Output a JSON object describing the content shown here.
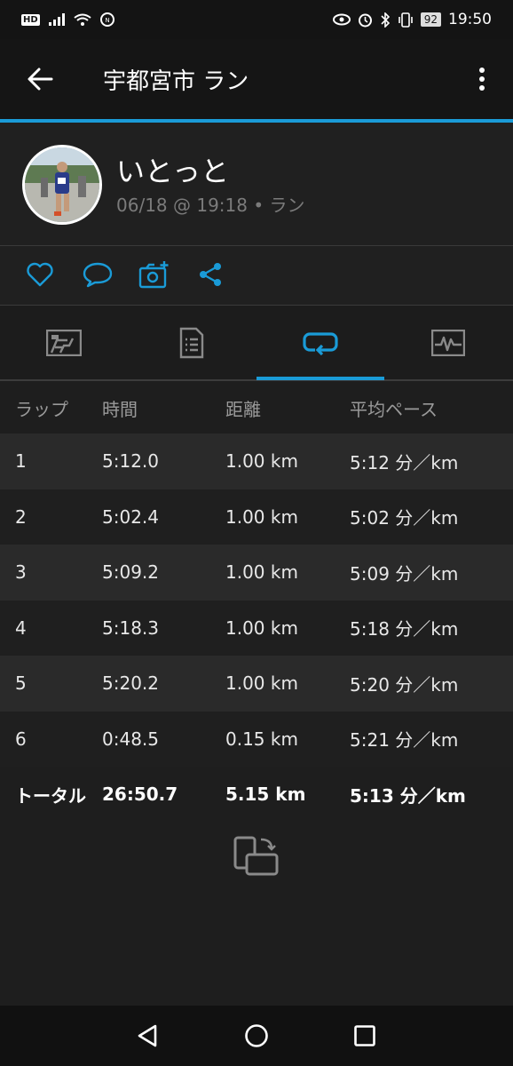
{
  "status_bar": {
    "hd": "HD",
    "battery": "92",
    "time": "19:50"
  },
  "app_bar": {
    "title": "宇都宮市 ラン"
  },
  "profile": {
    "name": "いとっと",
    "meta": "06/18 @ 19:18 • ラン"
  },
  "table": {
    "headers": {
      "lap": "ラップ",
      "time": "時間",
      "distance": "距離",
      "pace": "平均ペース"
    },
    "rows": [
      {
        "lap": "1",
        "time": "5:12.0",
        "distance": "1.00 km",
        "pace": "5:12 分／km"
      },
      {
        "lap": "2",
        "time": "5:02.4",
        "distance": "1.00 km",
        "pace": "5:02 分／km"
      },
      {
        "lap": "3",
        "time": "5:09.2",
        "distance": "1.00 km",
        "pace": "5:09 分／km"
      },
      {
        "lap": "4",
        "time": "5:18.3",
        "distance": "1.00 km",
        "pace": "5:18 分／km"
      },
      {
        "lap": "5",
        "time": "5:20.2",
        "distance": "1.00 km",
        "pace": "5:20 分／km"
      },
      {
        "lap": "6",
        "time": "0:48.5",
        "distance": "0.15 km",
        "pace": "5:21 分／km"
      }
    ],
    "total": {
      "label": "トータル",
      "time": "26:50.7",
      "distance": "5.15 km",
      "pace": "5:13 分／km"
    }
  },
  "colors": {
    "accent": "#1a9bd7",
    "background": "#1e1e1e",
    "row_alt": "#2a2a2a"
  },
  "icons": [
    "back-arrow-icon",
    "more-vert-icon",
    "heart-icon",
    "comment-icon",
    "add-photo-icon",
    "share-icon",
    "stats-tab-icon",
    "details-tab-icon",
    "laps-tab-icon",
    "chart-tab-icon",
    "rotate-screen-icon"
  ]
}
